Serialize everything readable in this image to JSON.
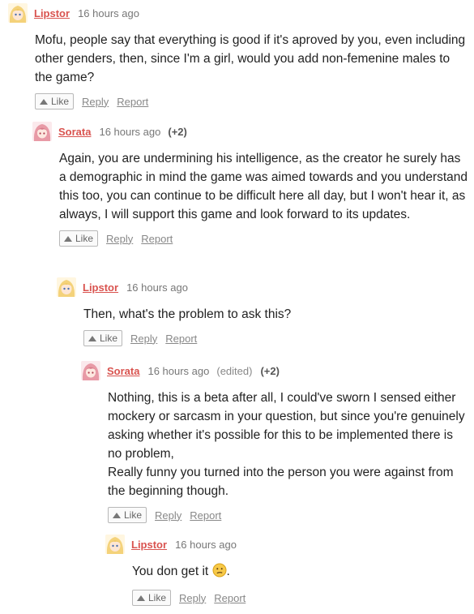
{
  "actions": {
    "like": "Like",
    "reply": "Reply",
    "report": "Report"
  },
  "comments": [
    {
      "author": "Lipstor",
      "time": "16 hours ago",
      "body": [
        "Mofu, people say that everything is good if it's aproved by you, even including other genders, then, since I'm a girl, would you add non-femenine males to the game?"
      ]
    },
    {
      "author": "Sorata",
      "time": "16 hours ago",
      "score": "(+2)",
      "body": [
        "Again, you are undermining his intelligence, as the creator he surely has a demographic in mind the game was aimed towards and you understand this too, you can continue to be difficult here all day, but I won't hear it, as always, I will support this game and look forward to its updates."
      ]
    },
    {
      "author": "Lipstor",
      "time": "16 hours ago",
      "body": [
        "Then, what's the problem to ask this?"
      ]
    },
    {
      "author": "Sorata",
      "time": "16 hours ago",
      "edited": "(edited)",
      "score": "(+2)",
      "body": [
        "Nothing, this is a beta after all, I could've sworn I sensed either mockery or sarcasm in your question, but since you're genuinely asking whether it's possible for this to be implemented there is no problem,",
        "Really funny you turned into the person you were against from the beginning though."
      ]
    },
    {
      "author": "Lipstor",
      "time": "16 hours ago",
      "body": [
        "You don get it"
      ],
      "trailing": "."
    }
  ],
  "avatars": {
    "lipstor": "blonde-avatar",
    "sorata": "pink-avatar"
  },
  "colors": {
    "author": "#d9534f",
    "meta": "#777777"
  }
}
